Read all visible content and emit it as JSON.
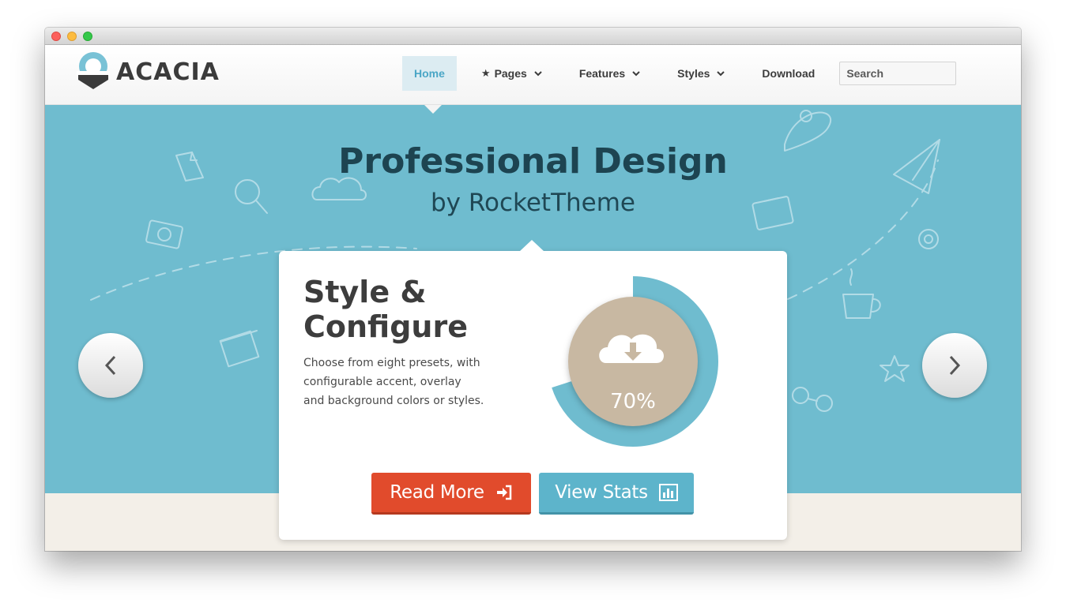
{
  "brand": {
    "name": "ACACIA",
    "colors": {
      "accent": "#5db4cb",
      "hero_bg": "#6fbccf",
      "cta": "#e14b2c",
      "progress_ring": "#6fbccf",
      "progress_inner": "#c8b8a2"
    }
  },
  "window": {
    "controls": [
      "close",
      "minimize",
      "maximize"
    ]
  },
  "nav": {
    "items": [
      {
        "label": "Home",
        "active": true,
        "icon": null,
        "dropdown": false
      },
      {
        "label": "Pages",
        "active": false,
        "icon": "star-icon",
        "dropdown": true
      },
      {
        "label": "Features",
        "active": false,
        "icon": null,
        "dropdown": true
      },
      {
        "label": "Styles",
        "active": false,
        "icon": null,
        "dropdown": true
      },
      {
        "label": "Download",
        "active": false,
        "icon": null,
        "dropdown": false
      }
    ],
    "search": {
      "placeholder": "Search",
      "value": ""
    }
  },
  "hero": {
    "title": "Professional Design",
    "subtitle": "by RocketTheme",
    "decorative_icons": [
      "document-icon",
      "search-icon",
      "cloud-icon",
      "camera-icon",
      "box-icon",
      "location-pin-icon",
      "paper-plane-icon",
      "briefcase-icon",
      "gear-icon",
      "coffee-cup-icon",
      "star-icon",
      "glasses-icon"
    ]
  },
  "slider": {
    "prev_icon": "chevron-left-icon",
    "next_icon": "chevron-right-icon"
  },
  "card": {
    "heading": "Style & Configure",
    "description": "Choose from eight presets, with configurable accent, overlay and background colors or styles.",
    "progress": {
      "value": 0.7,
      "label": "70%",
      "icon": "cloud-download-icon"
    },
    "buttons": {
      "read_more": {
        "label": "Read More",
        "icon": "sign-in-icon"
      },
      "view_stats": {
        "label": "View Stats",
        "icon": "bar-chart-icon"
      }
    }
  }
}
